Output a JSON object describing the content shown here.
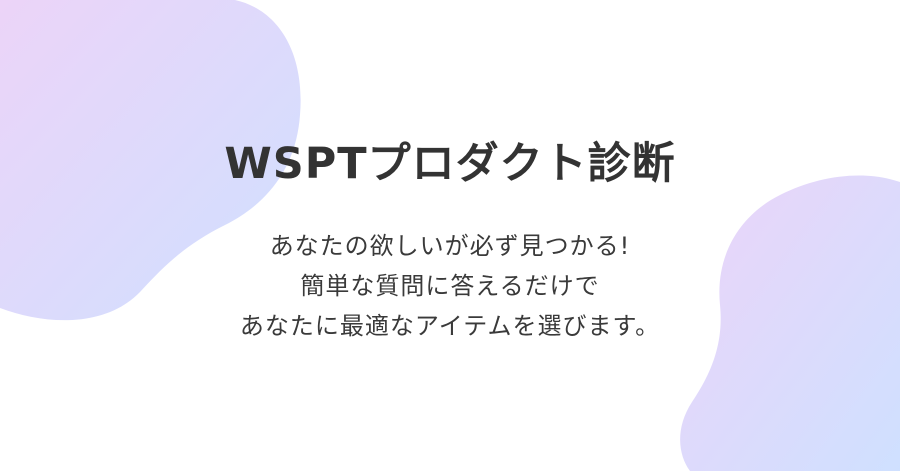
{
  "hero": {
    "title": "WSPTプロダクト診断",
    "subtitle_lines": [
      "あなたの欲しいが必ず見つかる!",
      "簡単な質問に答えるだけで",
      "あなたに最適なアイテムを選びます。"
    ]
  },
  "colors": {
    "background": "#ffffff",
    "text": "#333333",
    "gradient_start": "#ecd4f8",
    "gradient_end": "#cfe0ff"
  }
}
